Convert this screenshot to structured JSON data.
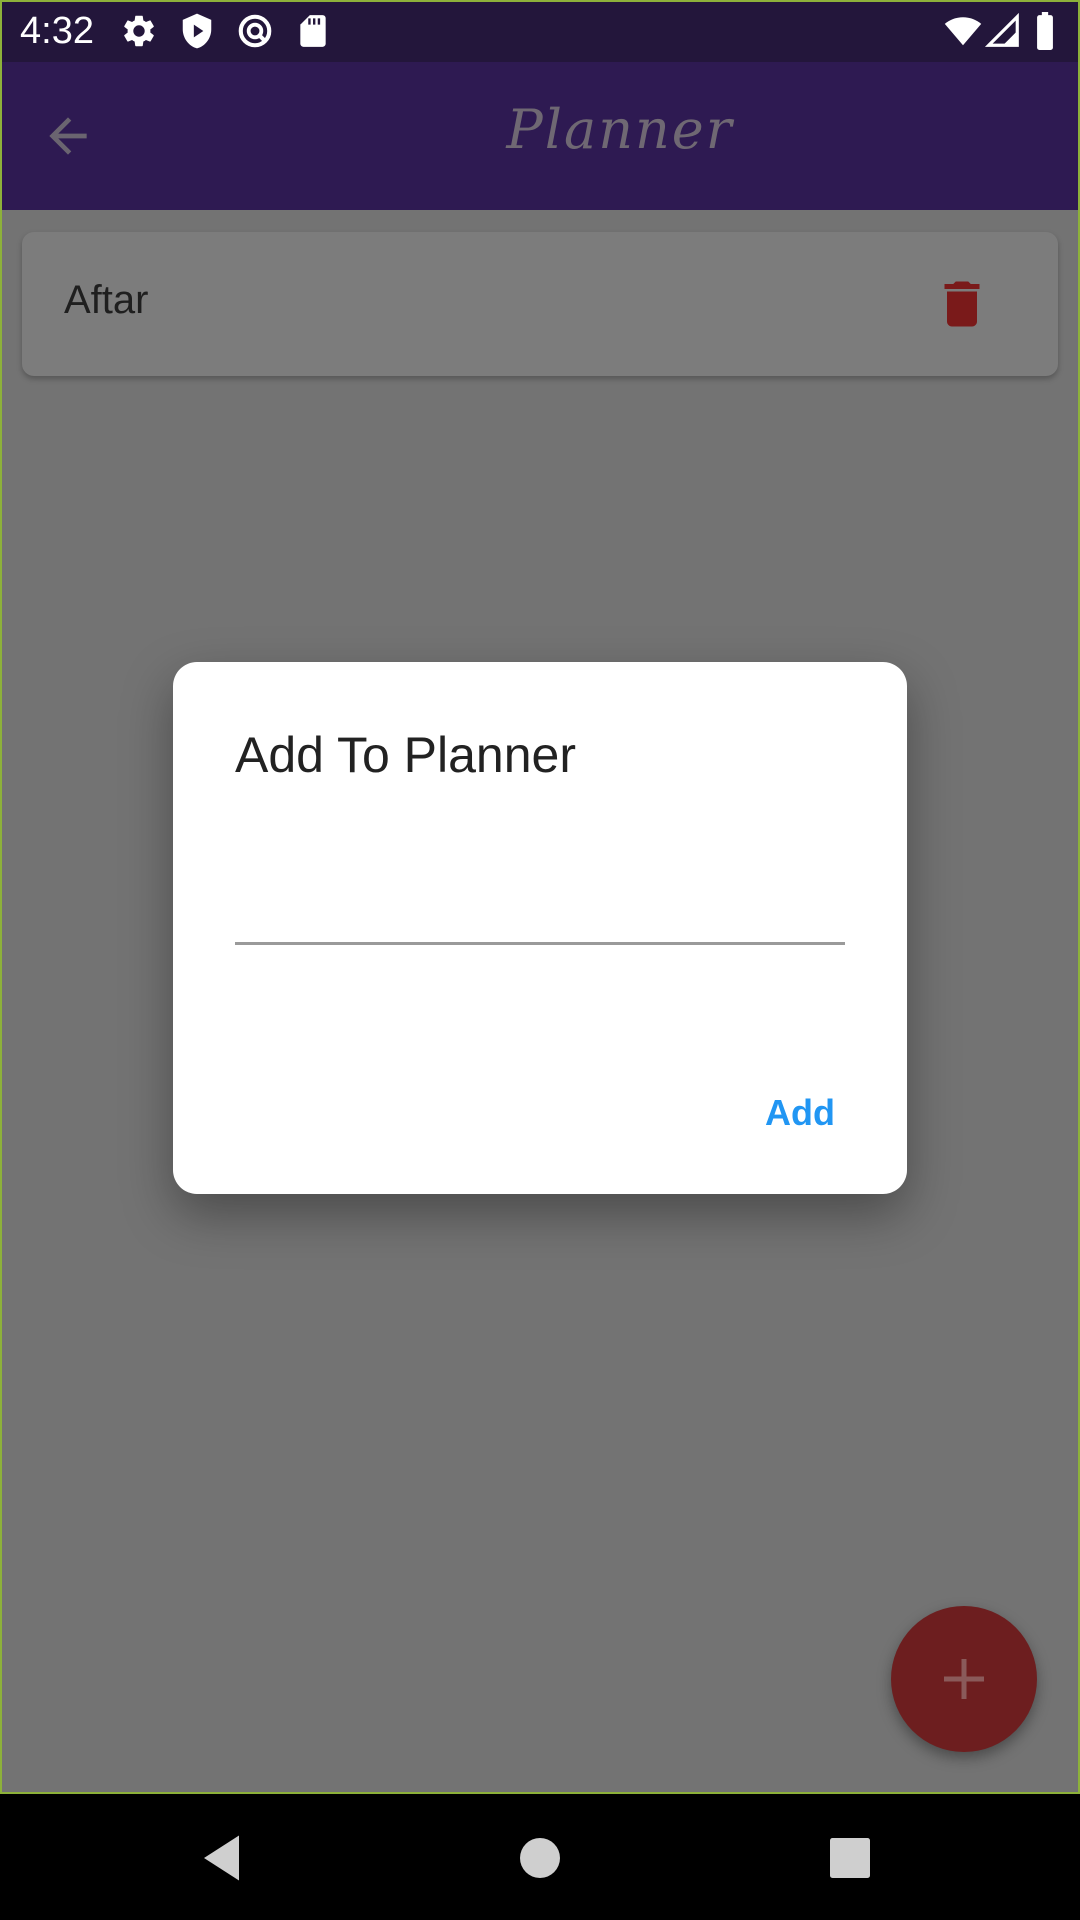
{
  "status_bar": {
    "time": "4:32",
    "left_icons": [
      "settings-icon",
      "shield-play-icon",
      "sync-icon",
      "sd-card-icon"
    ],
    "right_icons": [
      "wifi-icon",
      "cell-signal-icon",
      "battery-icon"
    ]
  },
  "app_bar": {
    "title": "Planner",
    "back_icon": "arrow-back-icon"
  },
  "list": {
    "items": [
      {
        "label": "Aftar",
        "action_icon": "trash-icon"
      }
    ]
  },
  "dialog": {
    "title": "Add To Planner",
    "input_value": "",
    "input_placeholder": "",
    "add_label": "Add"
  },
  "fab": {
    "icon": "plus-icon"
  },
  "nav_bar": {
    "buttons": [
      "back-triangle-icon",
      "home-circle-icon",
      "recents-square-icon"
    ]
  },
  "colors": {
    "status_bar": "#23163b",
    "app_bar": "#2e1a52",
    "scrim_background": "#737373",
    "delete_icon": "#7a1a1a",
    "fab": "#6d1e1f",
    "add_button": "#2196f3"
  }
}
